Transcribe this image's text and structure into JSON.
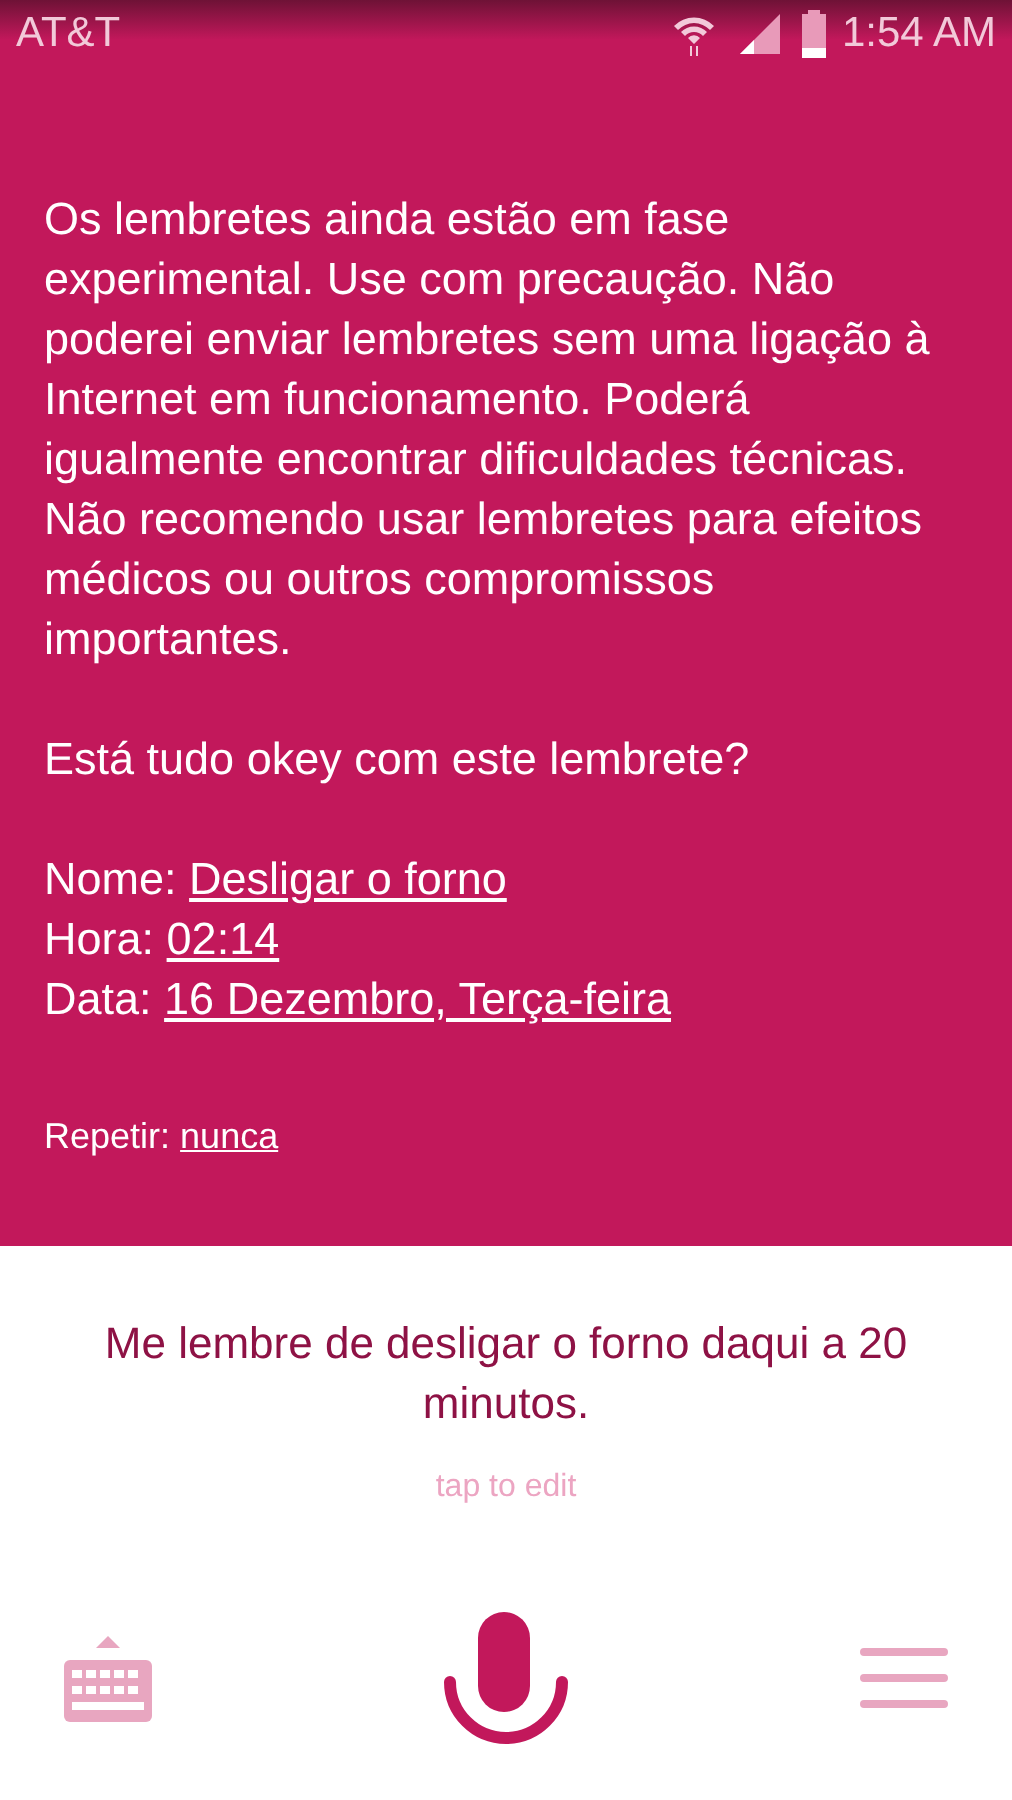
{
  "status_bar": {
    "carrier": "AT&T",
    "time": "1:54 AM"
  },
  "message": {
    "warning": "Os lembretes ainda estão em fase experimental. Use com precaução. Não poderei enviar lembretes sem uma ligação à Internet em funcionamento. Poderá igualmente encontrar dificuldades técnicas. Não recomendo usar lembretes para efeitos médicos ou outros compromissos importantes.",
    "question": "Está tudo okey com este lembrete?",
    "fields": [
      {
        "label": "Nome:",
        "value": "Desligar o forno"
      },
      {
        "label": "Hora:",
        "value": "02:14"
      },
      {
        "label": "Data:",
        "value": "16 Dezembro, Terça-feira"
      }
    ],
    "repeat": {
      "label": "Repetir:",
      "value": "nunca"
    }
  },
  "query": {
    "text": "Me lembre de desligar o forno daqui a 20 minutos.",
    "hint": "tap to edit"
  }
}
